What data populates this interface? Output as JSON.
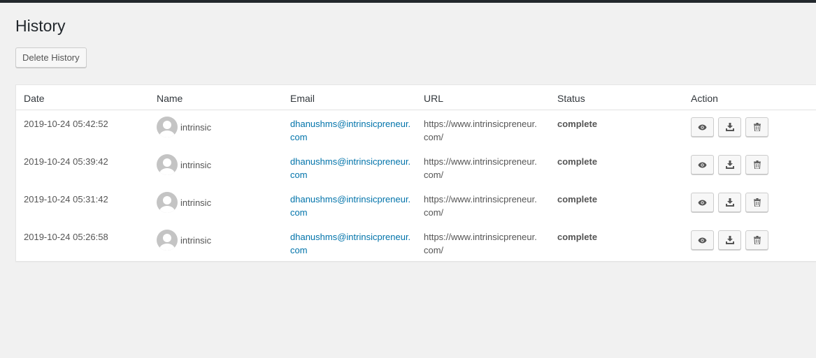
{
  "page": {
    "title": "History"
  },
  "toolbar": {
    "delete_label": "Delete History"
  },
  "table": {
    "headers": {
      "date": "Date",
      "name": "Name",
      "email": "Email",
      "url": "URL",
      "status": "Status",
      "action": "Action"
    },
    "rows": [
      {
        "date": "2019-10-24 05:42:52",
        "name": "intrinsic",
        "email_line1": "dhanushms@intrinsicpreneur.",
        "email_line2": "com",
        "url_line1": "https://www.intrinsicpreneur.",
        "url_line2": "com/",
        "status": "complete"
      },
      {
        "date": "2019-10-24 05:39:42",
        "name": "intrinsic",
        "email_line1": "dhanushms@intrinsicpreneur.",
        "email_line2": "com",
        "url_line1": "https://www.intrinsicpreneur.",
        "url_line2": "com/",
        "status": "complete"
      },
      {
        "date": "2019-10-24 05:31:42",
        "name": "intrinsic",
        "email_line1": "dhanushms@intrinsicpreneur.",
        "email_line2": "com",
        "url_line1": "https://www.intrinsicpreneur.",
        "url_line2": "com/",
        "status": "complete"
      },
      {
        "date": "2019-10-24 05:26:58",
        "name": "intrinsic",
        "email_line1": "dhanushms@intrinsicpreneur.",
        "email_line2": "com",
        "url_line1": "https://www.intrinsicpreneur.",
        "url_line2": "com/",
        "status": "complete"
      }
    ],
    "action_icons": [
      "eye-icon",
      "download-icon",
      "trash-icon"
    ]
  },
  "colors": {
    "link": "#0073aa",
    "topbar": "#23282d",
    "background": "#f1f1f1"
  }
}
